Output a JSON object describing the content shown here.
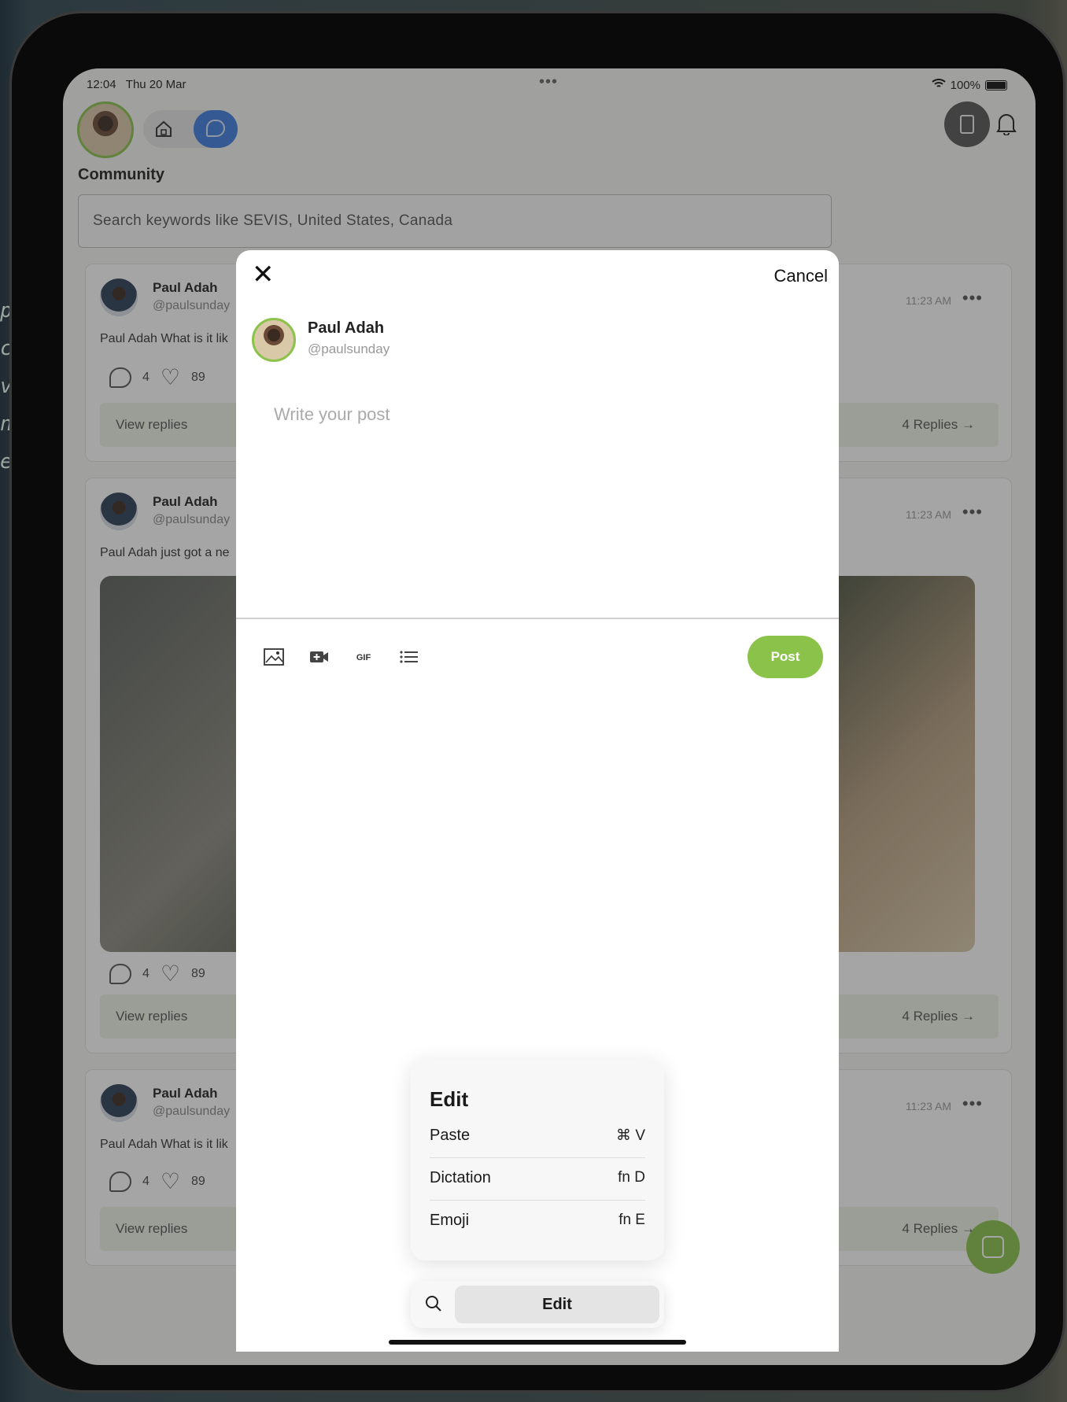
{
  "status_bar": {
    "time": "12:04",
    "date": "Thu 20 Mar",
    "battery": "100%"
  },
  "header": {
    "section_title": "Community",
    "search_placeholder": "Search keywords like SEVIS, United States, Canada"
  },
  "posts": [
    {
      "name": "Paul Adah",
      "handle": "@paulsunday",
      "time": "11:23 AM",
      "text": "Paul Adah What is it lik",
      "comments": "4",
      "likes": "89",
      "view_replies": "View replies",
      "replies": "4 Replies →"
    },
    {
      "name": "Paul Adah",
      "handle": "@paulsunday",
      "time": "11:23 AM",
      "text": "Paul Adah just got a ne",
      "comments": "4",
      "likes": "89",
      "view_replies": "View replies",
      "replies": "4 Replies →"
    },
    {
      "name": "Paul Adah",
      "handle": "@paulsunday",
      "time": "11:23 AM",
      "text": "Paul Adah What is it lik",
      "comments": "4",
      "likes": "89",
      "view_replies": "View replies",
      "replies": "4 Replies →"
    }
  ],
  "modal": {
    "close": "✕",
    "cancel": "Cancel",
    "user_name": "Paul Adah",
    "user_handle": "@paulsunday",
    "placeholder": "Write your post",
    "tools": [
      "image-icon",
      "video-icon",
      "gif-icon",
      "list-icon"
    ],
    "gif_label": "GIF",
    "post_button": "Post"
  },
  "edit_menu": {
    "title": "Edit",
    "items": [
      {
        "label": "Paste",
        "shortcut": "⌘ V"
      },
      {
        "label": "Dictation",
        "shortcut": "fn D"
      },
      {
        "label": "Emoji",
        "shortcut": "fn E"
      }
    ]
  },
  "edit_bar": {
    "button": "Edit"
  },
  "colors": {
    "accent": "#8bc34a",
    "toggle_active": "#3f7de0"
  }
}
